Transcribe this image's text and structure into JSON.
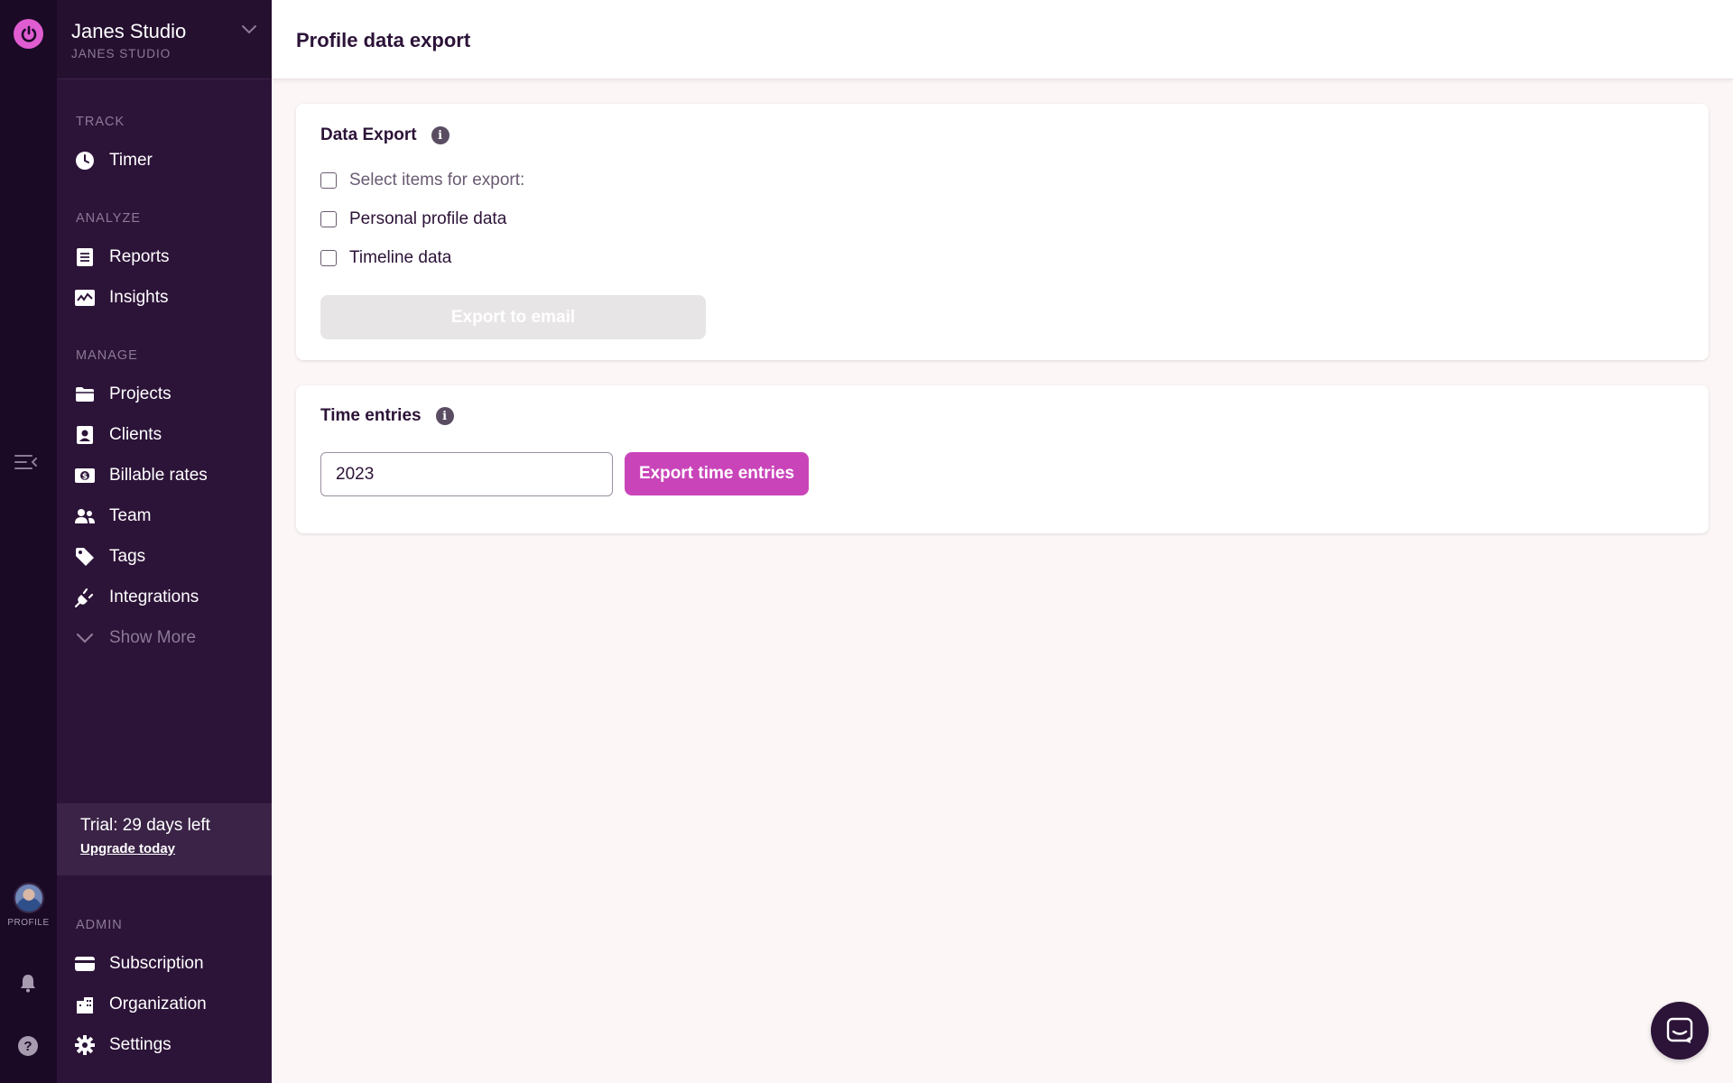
{
  "workspace": {
    "name": "Janes Studio",
    "subtitle": "JANES STUDIO"
  },
  "rail": {
    "profile_label": "PROFILE",
    "help_glyph": "?"
  },
  "sidebar": {
    "sections": {
      "track": "TRACK",
      "analyze": "ANALYZE",
      "manage": "MANAGE",
      "admin": "ADMIN"
    },
    "items": {
      "timer": "Timer",
      "reports": "Reports",
      "insights": "Insights",
      "projects": "Projects",
      "clients": "Clients",
      "billable_rates": "Billable rates",
      "team": "Team",
      "tags": "Tags",
      "integrations": "Integrations",
      "show_more": "Show More",
      "subscription": "Subscription",
      "organization": "Organization",
      "settings": "Settings"
    },
    "trial": {
      "text": "Trial: 29 days left",
      "link": "Upgrade today"
    }
  },
  "header": {
    "title": "Profile data export"
  },
  "data_export": {
    "title": "Data Export",
    "info_glyph": "i",
    "select_all_label": "Select items for export:",
    "options": [
      "Personal profile data",
      "Timeline data"
    ],
    "export_button": "Export to email"
  },
  "time_entries": {
    "title": "Time entries",
    "info_glyph": "i",
    "year_value": "2023",
    "export_button": "Export time entries"
  },
  "colors": {
    "rail": "#1a0a26",
    "sidebar": "#2c1338",
    "accent": "#c944b9",
    "logo": "#e05cd1",
    "background": "#fcf6f6"
  }
}
